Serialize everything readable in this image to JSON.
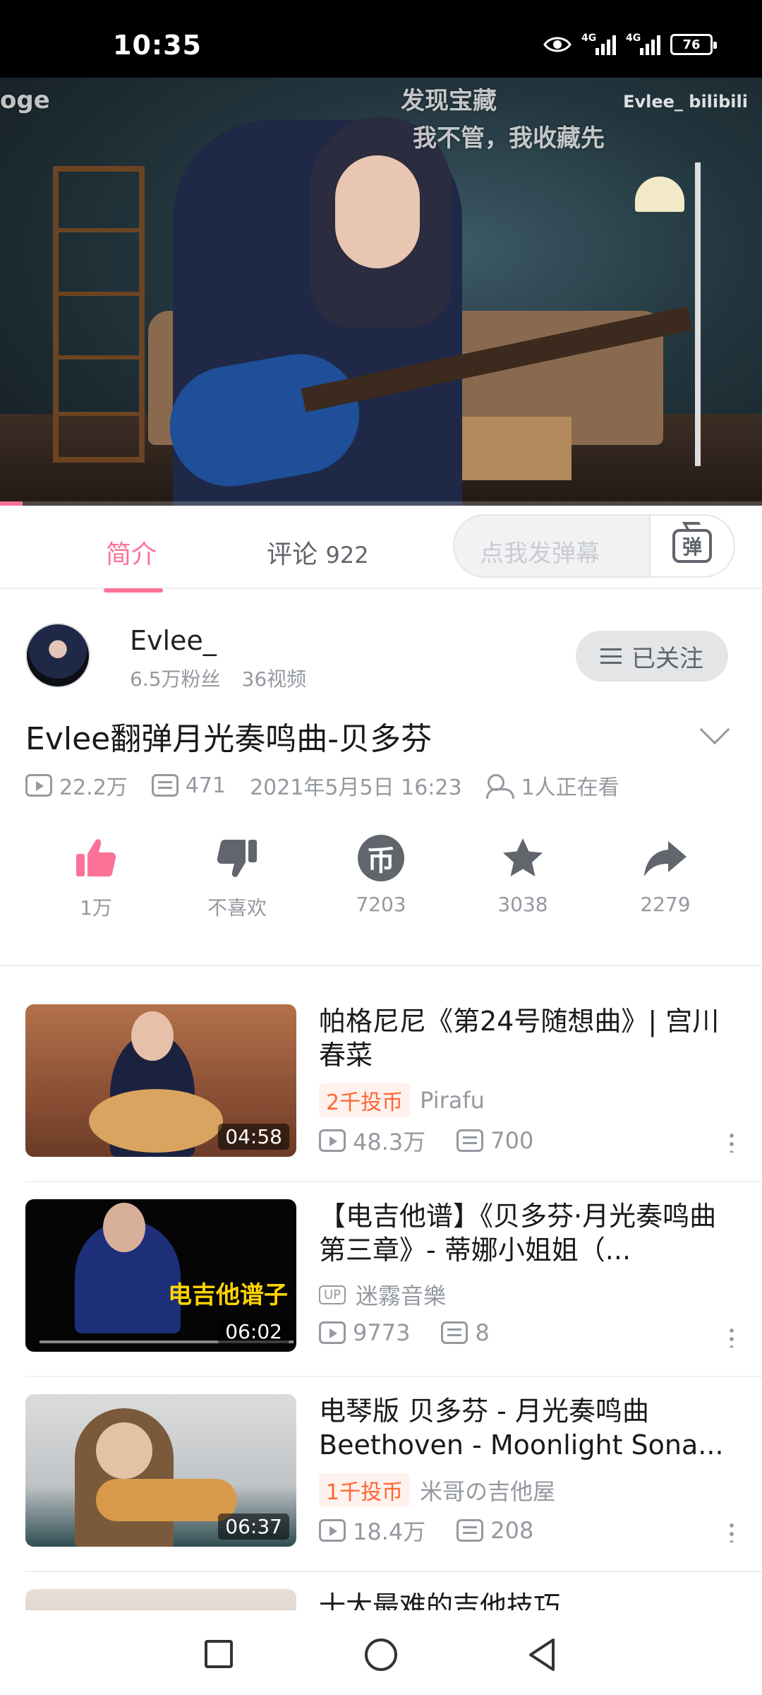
{
  "status_bar": {
    "time": "10:35",
    "battery": "76",
    "net1": "4G",
    "net2": "4G"
  },
  "video": {
    "danmaku": [
      "oge",
      "发现宝藏",
      "我不管，我收藏先"
    ],
    "watermark": "Evlee_ bilibili",
    "progress": 0.03
  },
  "tabs": {
    "intro": "简介",
    "comments_label": "评论",
    "comments_count": "922",
    "danmu_placeholder": "点我发弹幕",
    "danmu_button": "弹"
  },
  "uploader": {
    "name": "Evlee_",
    "fans": "6.5万粉丝",
    "videos": "36视频",
    "follow_label": "已关注"
  },
  "video_info": {
    "title": "Evlee翻弹月光奏鸣曲-贝多芬",
    "views": "22.2万",
    "danmaku_count": "471",
    "date": "2021年5月5日 16:23",
    "watching": "1人正在看"
  },
  "actions": {
    "like": "1万",
    "dislike": "不喜欢",
    "coin": "7203",
    "coin_glyph": "币",
    "favorite": "3038",
    "share": "2279"
  },
  "colors": {
    "brand_pink": "#fb7299",
    "coin_orange": "#ff6633"
  },
  "recommendations": [
    {
      "title": "帕格尼尼《第24号随想曲》| 宫川春菜",
      "badge": "2千投币",
      "author": "Pirafu",
      "views": "48.3万",
      "danmaku": "700",
      "duration": "04:58"
    },
    {
      "title": "【电吉他谱】《贝多芬·月光奏鸣曲第三章》- 蒂娜小姐姐（...",
      "up_tag": "UP",
      "author": "迷霧音樂",
      "views": "9773",
      "danmaku": "8",
      "duration": "06:02",
      "thumb_text": "电吉他谱子"
    },
    {
      "title": "电琴版 贝多芬 - 月光奏鸣曲 Beethoven - Moonlight Sona...",
      "badge": "1千投币",
      "author": "米哥の吉他屋",
      "views": "18.4万",
      "danmaku": "208",
      "duration": "06:37"
    },
    {
      "title": "十大最难的吉他技巧"
    }
  ]
}
